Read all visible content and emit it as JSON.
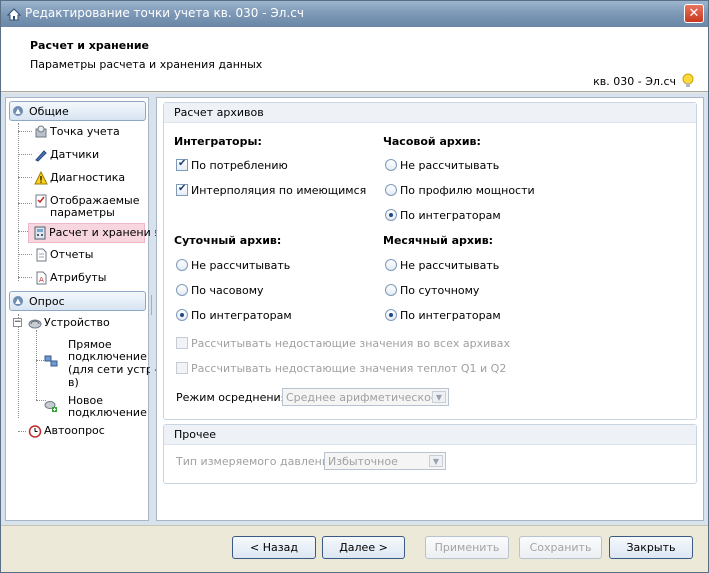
{
  "window": {
    "title": "Редактирование точки учета кв. 030 - Эл.сч",
    "close_label": "✕"
  },
  "header": {
    "title": "Расчет и хранение",
    "subtitle": "Параметры расчета и хранения данных",
    "object": "кв. 030 - Эл.сч"
  },
  "tree": {
    "group_general": "Общие",
    "item_point": "Точка учета",
    "item_sensors": "Датчики",
    "item_diagnostics": "Диагностика",
    "item_display_params_1": "Отображаемые",
    "item_display_params_2": "параметры",
    "item_calc": "Расчет и хранение",
    "item_reports": "Отчеты",
    "item_attributes": "Атрибуты",
    "group_poll": "Опрос",
    "item_device": "Устройство",
    "item_direct_1": "Прямое",
    "item_direct_2": "подключение",
    "item_direct_3": "(для сети устр-",
    "item_direct_4": "в)",
    "item_new_1": "Новое",
    "item_new_2": "подключение",
    "item_autopoll": "Автоопрос"
  },
  "archives": {
    "legend": "Расчет архивов",
    "integrators_label": "Интеграторы:",
    "by_consumption": "По потреблению",
    "by_consumption_checked": true,
    "interpolation": "Интерполяция по имеющимся",
    "interpolation_checked": true,
    "hourly_label": "Часовой архив:",
    "hourly_options": [
      "Не рассчитывать",
      "По профилю мощности",
      "По интеграторам"
    ],
    "hourly_selected": 2,
    "daily_label": "Суточный архив:",
    "daily_options": [
      "Не рассчитывать",
      "По часовому",
      "По интеграторам"
    ],
    "daily_selected": 2,
    "monthly_label": "Месячный архив:",
    "monthly_options": [
      "Не рассчитывать",
      "По суточному",
      "По интеграторам"
    ],
    "monthly_selected": 2,
    "calc_missing_all": "Рассчитывать недостающие значения во всех архивах",
    "calc_missing_q": "Рассчитывать недостающие значения теплот Q1 и Q2",
    "averaging_label": "Режим осреднения:",
    "averaging_value": "Среднее арифметическое"
  },
  "other": {
    "legend": "Прочее",
    "pressure_label": "Тип измеряемого давления:",
    "pressure_value": "Избыточное"
  },
  "buttons": {
    "back": "< Назад",
    "next": "Далее >",
    "apply": "Применить",
    "save": "Сохранить",
    "close": "Закрыть"
  }
}
